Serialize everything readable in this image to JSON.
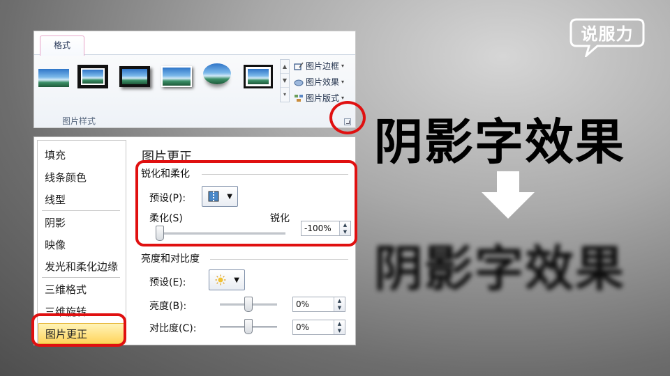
{
  "logo": {
    "text": "说服力"
  },
  "ribbon": {
    "tab_label": "格式",
    "group_label": "图片样式",
    "gallery_scroll": [
      "▲",
      "▼",
      "▾"
    ],
    "commands": [
      {
        "icon": "picture-border-icon",
        "label": "图片边框"
      },
      {
        "icon": "picture-effects-icon",
        "label": "图片效果"
      },
      {
        "icon": "picture-layout-icon",
        "label": "图片版式"
      }
    ]
  },
  "dialog": {
    "nav": [
      "填充",
      "线条颜色",
      "线型",
      "阴影",
      "映像",
      "发光和柔化边缘",
      "三维格式",
      "三维旋转",
      "图片更正"
    ],
    "selected_nav": "图片更正",
    "title": "图片更正",
    "sharpen_section": {
      "title": "锐化和柔化",
      "preset_label": "预设(P):",
      "soften_label": "柔化(S)",
      "sharpen_label": "锐化",
      "value": "-100%",
      "slider_fraction": 0.0
    },
    "brightness_section": {
      "title": "亮度和对比度",
      "preset_label": "预设(E):",
      "brightness_label": "亮度(B):",
      "brightness_value": "0%",
      "brightness_fraction": 0.5,
      "contrast_label": "对比度(C):",
      "contrast_value": "0%",
      "contrast_fraction": 0.5
    }
  },
  "headline": "阴影字效果",
  "headline_blurred": "阴影字效果",
  "colors": {
    "highlight": "#e01010",
    "selected_nav_bg": "#ffd45c"
  }
}
